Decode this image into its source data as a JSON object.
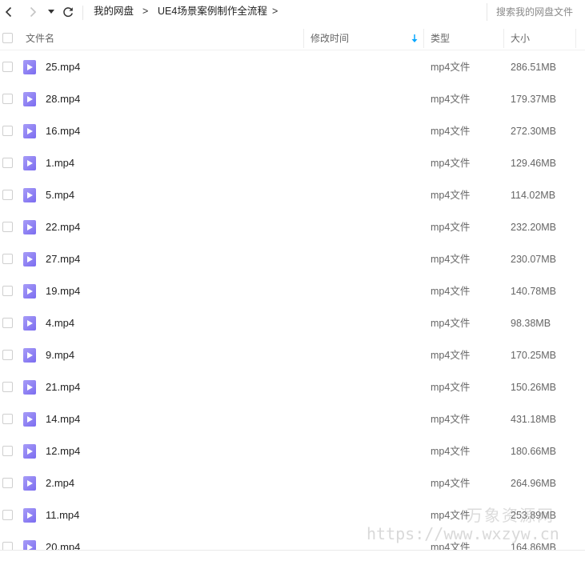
{
  "toolbar": {
    "back_icon": "chevron-left-icon",
    "forward_icon": "chevron-right-icon",
    "history_icon": "caret-down-icon",
    "refresh_icon": "refresh-icon",
    "breadcrumb": [
      "我的网盘",
      "UE4场景案例制作全流程"
    ],
    "crumb_separator": ">",
    "search_placeholder": "搜索我的网盘文件"
  },
  "header": {
    "name": "文件名",
    "modified": "修改时间",
    "type": "类型",
    "size": "大小",
    "sort_icon": "sort-down-arrow-icon"
  },
  "colors": {
    "file_icon": "#8c7ff3",
    "sort_arrow": "#06a7ff"
  },
  "files": [
    {
      "name": "25.mp4",
      "type": "mp4文件",
      "size": "286.51MB"
    },
    {
      "name": "28.mp4",
      "type": "mp4文件",
      "size": "179.37MB"
    },
    {
      "name": "16.mp4",
      "type": "mp4文件",
      "size": "272.30MB"
    },
    {
      "name": "1.mp4",
      "type": "mp4文件",
      "size": "129.46MB"
    },
    {
      "name": "5.mp4",
      "type": "mp4文件",
      "size": "114.02MB"
    },
    {
      "name": "22.mp4",
      "type": "mp4文件",
      "size": "232.20MB"
    },
    {
      "name": "27.mp4",
      "type": "mp4文件",
      "size": "230.07MB"
    },
    {
      "name": "19.mp4",
      "type": "mp4文件",
      "size": "140.78MB"
    },
    {
      "name": "4.mp4",
      "type": "mp4文件",
      "size": "98.38MB"
    },
    {
      "name": "9.mp4",
      "type": "mp4文件",
      "size": "170.25MB"
    },
    {
      "name": "21.mp4",
      "type": "mp4文件",
      "size": "150.26MB"
    },
    {
      "name": "14.mp4",
      "type": "mp4文件",
      "size": "431.18MB"
    },
    {
      "name": "12.mp4",
      "type": "mp4文件",
      "size": "180.66MB"
    },
    {
      "name": "2.mp4",
      "type": "mp4文件",
      "size": "264.96MB"
    },
    {
      "name": "11.mp4",
      "type": "mp4文件",
      "size": "253.89MB"
    },
    {
      "name": "20.mp4",
      "type": "mp4文件",
      "size": "164.86MB"
    }
  ],
  "watermark": {
    "text": "万象资源网",
    "url": "https://www.wxzyw.cn"
  }
}
